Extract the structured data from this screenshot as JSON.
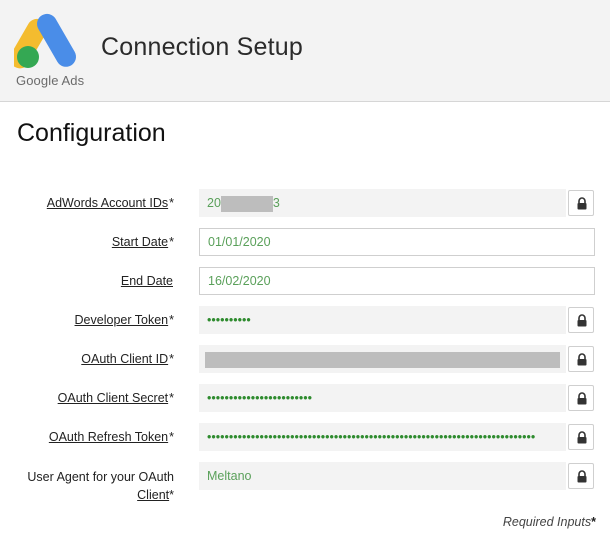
{
  "header": {
    "logo_text": "Google Ads",
    "title": "Connection Setup"
  },
  "section_title": "Configuration",
  "fields": {
    "account_ids": {
      "label": "AdWords Account IDs",
      "required": "*",
      "value_prefix": "20",
      "value_suffix": "3"
    },
    "start_date": {
      "label": "Start Date",
      "required": "*",
      "value": "01/01/2020"
    },
    "end_date": {
      "label": "End Date",
      "required": "",
      "value": "16/02/2020"
    },
    "developer_token": {
      "label": "Developer Token",
      "required": "*",
      "value": "••••••••••"
    },
    "oauth_client_id": {
      "label": "OAuth Client ID",
      "required": "*"
    },
    "oauth_client_secret": {
      "label": "OAuth Client Secret",
      "required": "*",
      "value": "••••••••••••••••••••••••"
    },
    "oauth_refresh_token": {
      "label": "OAuth Refresh Token",
      "required": "*",
      "value": "•••••••••••••••••••••••••••••••••••••••••••••••••••••••••••••••••••••••••••"
    },
    "user_agent": {
      "label_line1": "User Agent for your OAuth",
      "label_line2": "Client",
      "required": "*",
      "value": "Meltano"
    }
  },
  "footer": {
    "note": "Required Inputs",
    "marker": "*"
  },
  "colors": {
    "value_text": "#5aa05a",
    "masked_text": "#2e8b2e",
    "header_bg": "#f3f3f3"
  },
  "icons": {
    "lock": "lock-icon"
  }
}
